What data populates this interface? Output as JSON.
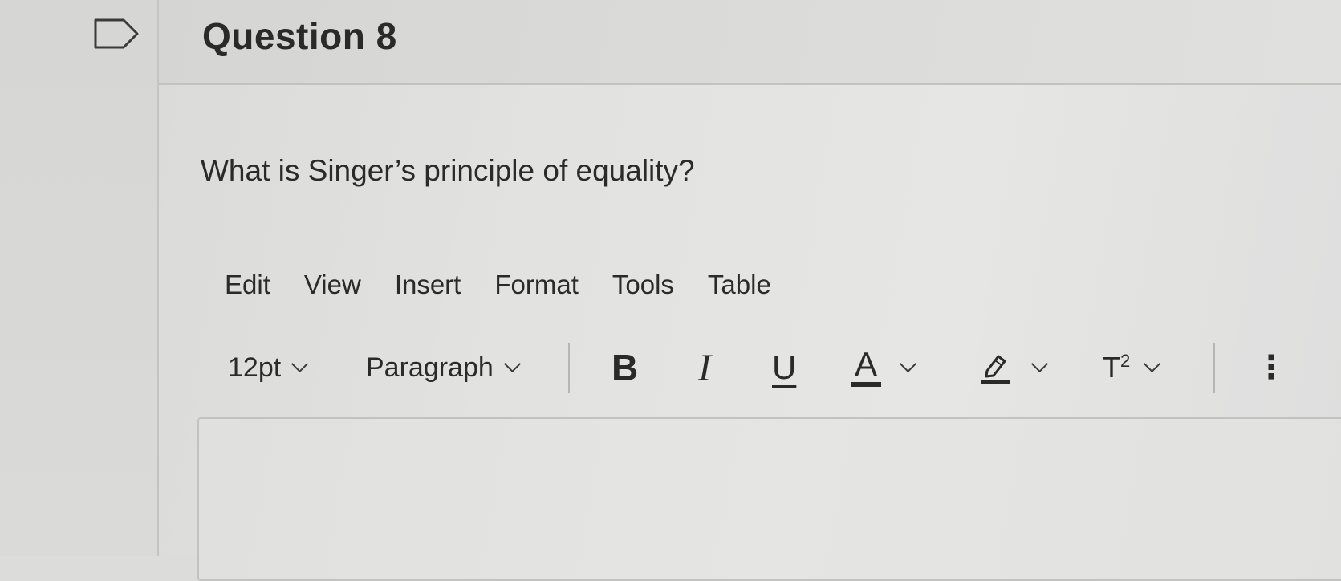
{
  "question": {
    "title": "Question 8",
    "text": "What is Singer’s principle of equality?"
  },
  "editor": {
    "menu": [
      "Edit",
      "View",
      "Insert",
      "Format",
      "Tools",
      "Table"
    ],
    "toolbar": {
      "font_size": "12pt",
      "block_format": "Paragraph",
      "bold": "B",
      "italic": "I",
      "underline": "U",
      "text_color": "A",
      "superscript_base": "T",
      "superscript_exp": "2",
      "more": "⋮"
    },
    "content": ""
  },
  "icons": {
    "flag": "flag-outline-icon",
    "highlight": "highlighter-icon",
    "more": "vertical-ellipsis-icon"
  },
  "colors": {
    "text": "#2a2a2a",
    "underline_bar": "#2a2a2a"
  }
}
